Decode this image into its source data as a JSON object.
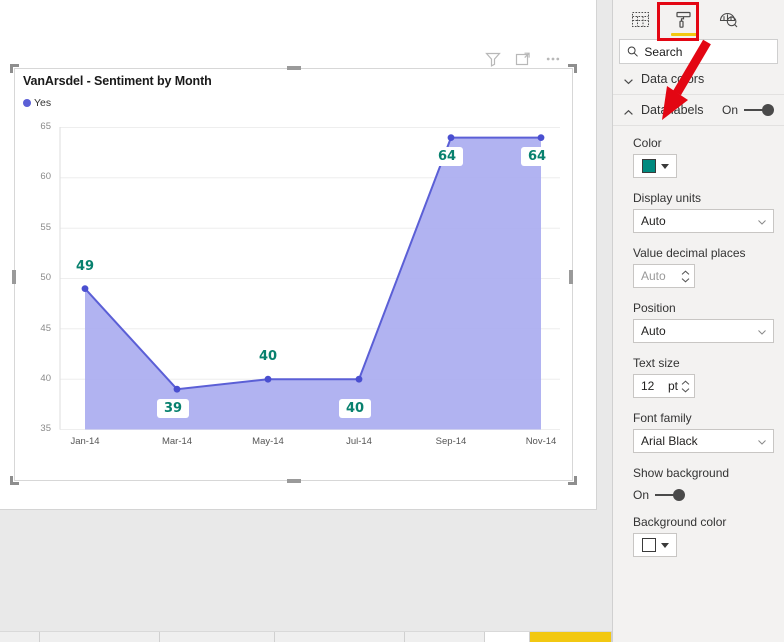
{
  "visual": {
    "title": "VanArsdel - Sentiment by Month",
    "legend_label": "Yes",
    "icons": {
      "filter": "filter-icon",
      "focus": "focus-mode-icon",
      "more": "more-options-icon"
    }
  },
  "chart_data": {
    "type": "area",
    "title": "VanArsdel - Sentiment by Month",
    "xlabel": "",
    "ylabel": "",
    "categories": [
      "Jan-14",
      "Mar-14",
      "May-14",
      "Jul-14",
      "Sep-14",
      "Nov-14"
    ],
    "series": [
      {
        "name": "Yes",
        "values": [
          49,
          39,
          40,
          40,
          64,
          64
        ]
      }
    ],
    "data_labels": [
      "49",
      "39",
      "40",
      "40",
      "64",
      "64"
    ],
    "ylim": [
      35,
      65
    ],
    "yticks": [
      "35",
      "40",
      "45",
      "50",
      "55",
      "60",
      "65"
    ],
    "grid": true,
    "legend_position": "top-left",
    "line_color": "#5b5fd6",
    "area_color": "#aaadf0",
    "label_color": "#08816e"
  },
  "pane": {
    "tabs": [
      {
        "name": "fields-tab",
        "icon": "fields-grid-icon",
        "active": false
      },
      {
        "name": "format-tab",
        "icon": "paint-roller-icon",
        "active": true
      },
      {
        "name": "analytics-tab",
        "icon": "analytics-magnifier-icon",
        "active": false
      }
    ],
    "search": {
      "placeholder": "Search"
    },
    "sections": [
      {
        "title": "Data colors",
        "expanded": false,
        "toggle": null
      },
      {
        "title": "Data labels",
        "expanded": true,
        "toggle": "On"
      }
    ],
    "properties": {
      "color_label": "Color",
      "color_value": "#008a7f",
      "display_units_label": "Display units",
      "display_units_value": "Auto",
      "decimal_places_label": "Value decimal places",
      "decimal_places_value": "Auto",
      "position_label": "Position",
      "position_value": "Auto",
      "text_size_label": "Text size",
      "text_size_value": "12",
      "text_size_unit": "pt",
      "font_family_label": "Font family",
      "font_family_value": "Arial Black",
      "show_background_label": "Show background",
      "show_background_value": "On",
      "background_color_label": "Background color",
      "background_color_value": "#ffffff"
    }
  },
  "annotation": {
    "highlight_color": "#e30613",
    "arrow_color": "#e30613"
  }
}
